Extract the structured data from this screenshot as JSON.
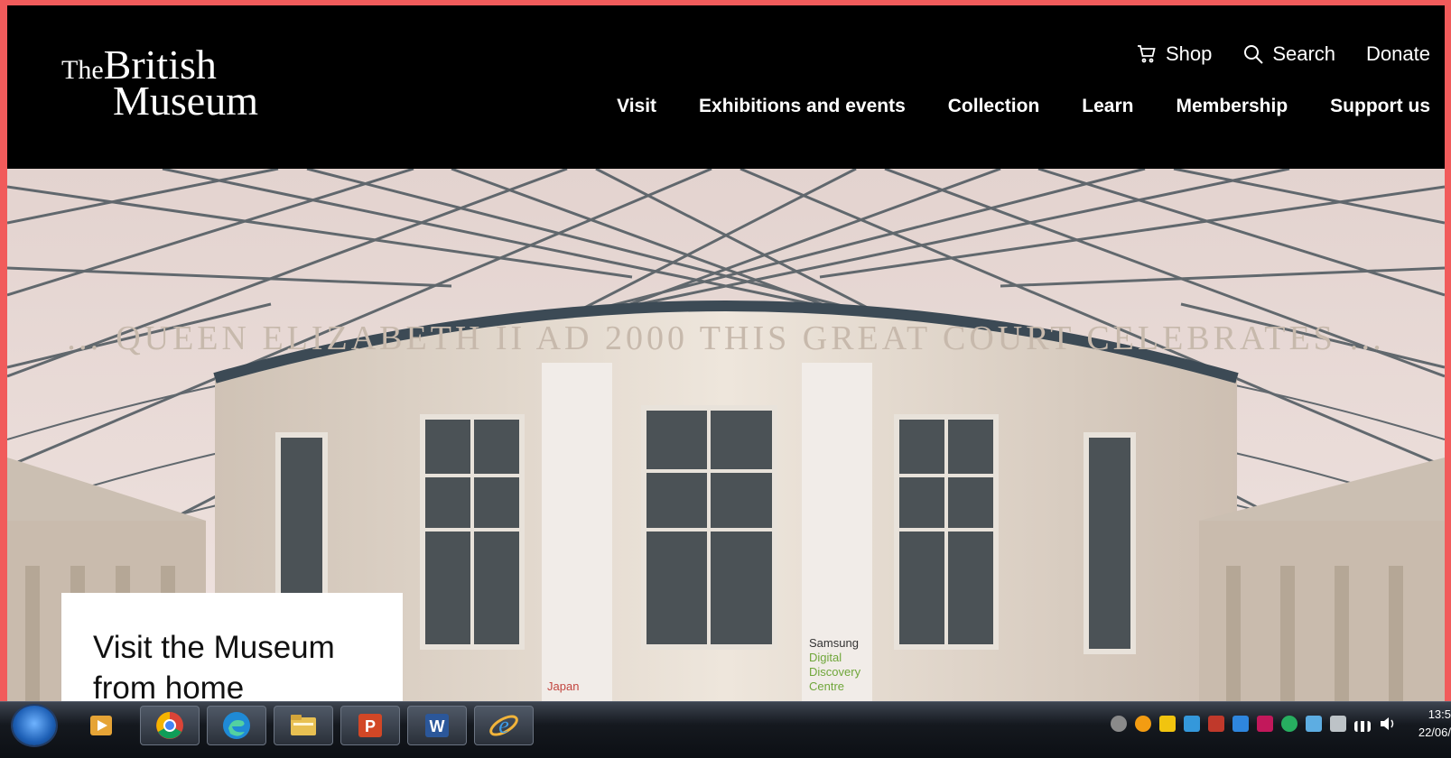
{
  "site": {
    "logo": {
      "the": "The",
      "line1": "British",
      "line2": "Museum"
    },
    "utility": [
      {
        "label": "Shop",
        "icon": "cart-icon"
      },
      {
        "label": "Search",
        "icon": "search-icon"
      },
      {
        "label": "Donate"
      }
    ],
    "nav": [
      "Visit",
      "Exhibitions and events",
      "Collection",
      "Learn",
      "Membership",
      "Support us"
    ]
  },
  "hero": {
    "inscription": "… QUEEN ELIZABETH II AD 2000 THIS GREAT COURT CELEBRATES …",
    "banner_left": "Japan",
    "banner_right": [
      "Samsung",
      "Digital",
      "Discovery",
      "Centre"
    ],
    "card_title": "Visit the Museum from home"
  },
  "taskbar": {
    "apps": [
      "windows-media-player-icon",
      "chrome-icon",
      "edge-icon",
      "file-explorer-icon",
      "powerpoint-icon",
      "word-icon",
      "internet-explorer-icon"
    ],
    "clock_time": "13:5",
    "clock_date": "22/06/"
  },
  "colors": {
    "border": "#f15b5b",
    "header": "#000000",
    "text": "#ffffff"
  }
}
